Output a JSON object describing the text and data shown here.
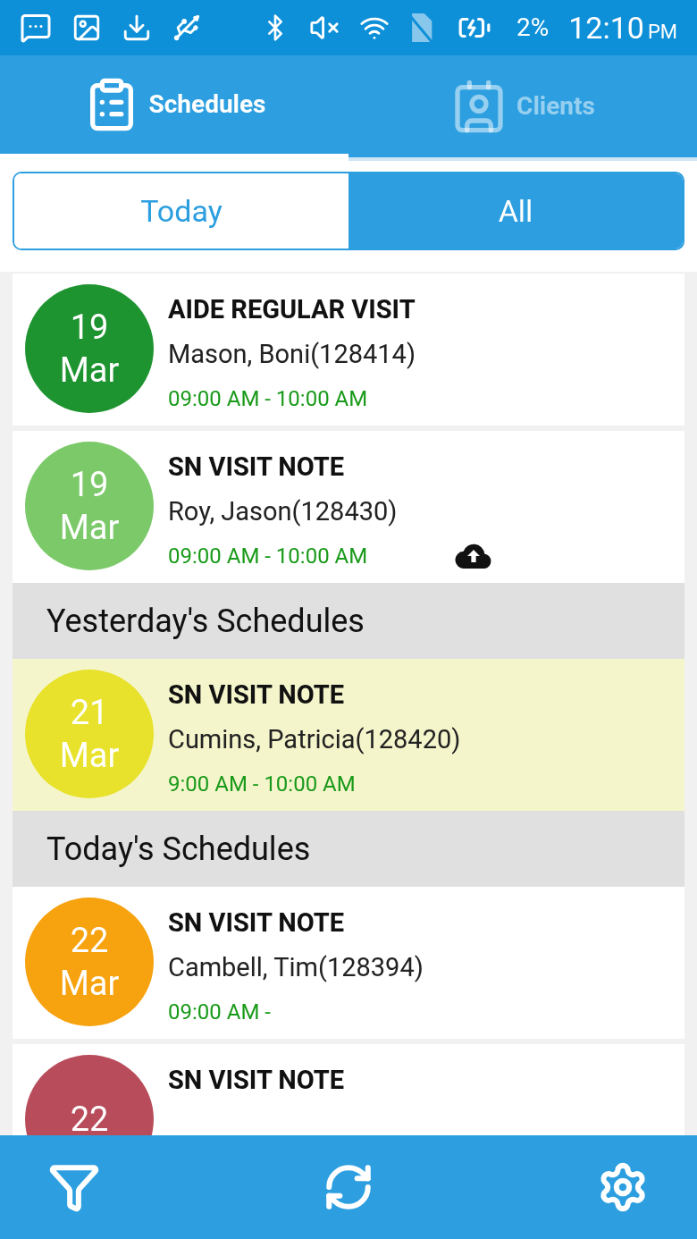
{
  "status_bar": {
    "battery": "2%",
    "time": "12:10",
    "period": "PM"
  },
  "tabs": [
    {
      "label": "Schedules",
      "selected": true
    },
    {
      "label": "Clients",
      "selected": false
    }
  ],
  "segments": [
    {
      "label": "Today",
      "selected": false
    },
    {
      "label": "All",
      "selected": true
    }
  ],
  "list": [
    {
      "kind": "visit",
      "day": "19",
      "month": "Mar",
      "title": "AIDE REGULAR VISIT",
      "client": "Mason, Boni(128414)",
      "time": "09:00 AM - 10:00 AM",
      "color": "#1e9430",
      "highlighted": false,
      "upload_pending": false
    },
    {
      "kind": "visit",
      "day": "19",
      "month": "Mar",
      "title": "SN VISIT NOTE",
      "client": "Roy, Jason(128430)",
      "time": "09:00 AM - 10:00 AM",
      "color": "#7cc96a",
      "highlighted": false,
      "upload_pending": true
    },
    {
      "kind": "header",
      "label": "Yesterday's Schedules"
    },
    {
      "kind": "visit",
      "day": "21",
      "month": "Mar",
      "title": "SN VISIT NOTE",
      "client": "Cumins, Patricia(128420)",
      "time": "9:00 AM - 10:00 AM",
      "color": "#e8e22c",
      "highlighted": true,
      "upload_pending": false
    },
    {
      "kind": "header",
      "label": "Today's Schedules"
    },
    {
      "kind": "visit",
      "day": "22",
      "month": "Mar",
      "title": "SN VISIT NOTE",
      "client": "Cambell, Tim(128394)",
      "time": "09:00 AM -",
      "color": "#f7a20f",
      "highlighted": false,
      "upload_pending": false
    },
    {
      "kind": "visit",
      "day": "22",
      "title": "SN VISIT NOTE",
      "color": "#b84c5a",
      "highlighted": false,
      "upload_pending": false
    }
  ]
}
